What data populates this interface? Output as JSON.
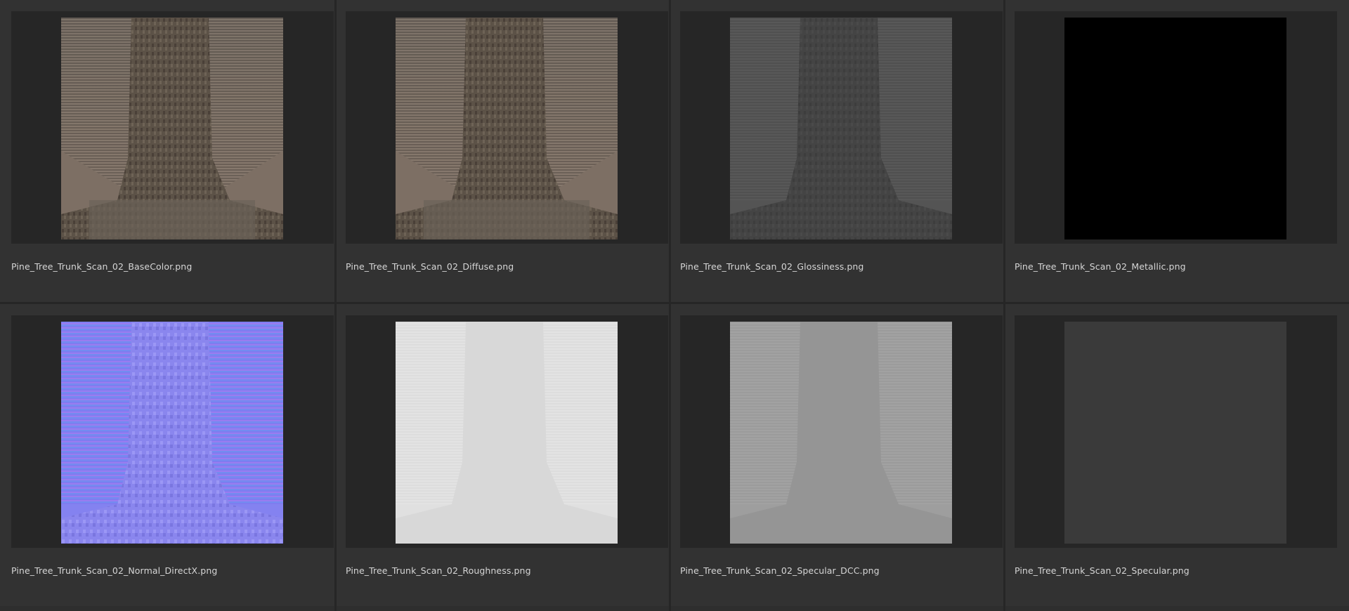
{
  "tiles": [
    {
      "filename": "Pine_Tree_Trunk_Scan_02_BaseColor.png",
      "map": "basecolor"
    },
    {
      "filename": "Pine_Tree_Trunk_Scan_02_Diffuse.png",
      "map": "diffuse"
    },
    {
      "filename": "Pine_Tree_Trunk_Scan_02_Glossiness.png",
      "map": "glossiness"
    },
    {
      "filename": "Pine_Tree_Trunk_Scan_02_Metallic.png",
      "map": "metallic"
    },
    {
      "filename": "Pine_Tree_Trunk_Scan_02_Normal_DirectX.png",
      "map": "normal"
    },
    {
      "filename": "Pine_Tree_Trunk_Scan_02_Roughness.png",
      "map": "roughness"
    },
    {
      "filename": "Pine_Tree_Trunk_Scan_02_Specular_DCC.png",
      "map": "specular-dcc"
    },
    {
      "filename": "Pine_Tree_Trunk_Scan_02_Specular.png",
      "map": "specular"
    }
  ],
  "colors": {
    "background": "#2e2e2e",
    "cell": "#323232",
    "thumb_bg": "#262626",
    "label": "#d6d6d6"
  }
}
